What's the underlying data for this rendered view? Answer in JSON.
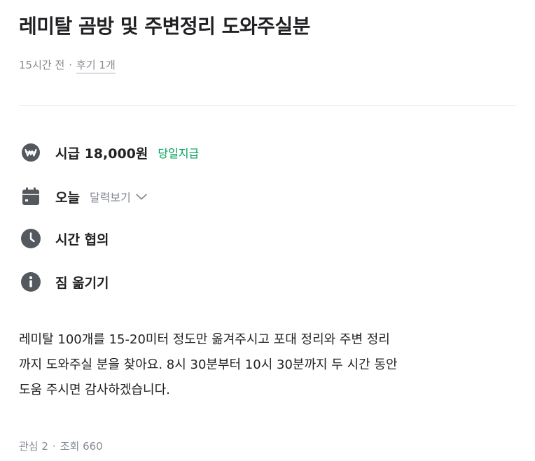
{
  "post": {
    "title": "레미탈 곰방 및 주변정리 도와주실분",
    "time_ago": "15시간 전",
    "separator": "·",
    "review_count": "후기 1개"
  },
  "details": {
    "wage": "시급 18,000원",
    "wage_badge": "당일지급",
    "date": "오늘",
    "calendar_link": "달력보기",
    "time": "시간 협의",
    "job_type": "짐 옮기기"
  },
  "description": {
    "lines": [
      "레미탈 100개를 15-20미터 정도만 옮겨주시고 포대 정리와 주변 정리",
      "까지 도와주실 분을 찾아요. 8시 30분부터 10시 30분까지 두 시간 동안",
      "도움 주시면 감사하겠습니다."
    ]
  },
  "stats": {
    "interest": "관심 2",
    "separator": "·",
    "views": "조회 660"
  },
  "icons": {
    "wage": "won-coin-icon",
    "date": "calendar-icon",
    "time": "clock-icon",
    "job_type": "info-icon",
    "dropdown": "chevron-down-icon"
  },
  "colors": {
    "icon_gray": "#54595f",
    "accent_green": "#00a05b",
    "muted_text": "#868b94",
    "primary_text": "#212124"
  }
}
